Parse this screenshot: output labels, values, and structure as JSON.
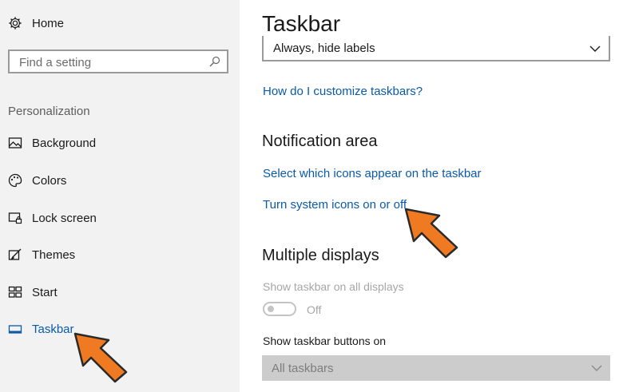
{
  "sidebar": {
    "home_label": "Home",
    "search_placeholder": "Find a setting",
    "section_label": "Personalization",
    "items": [
      {
        "label": "Background"
      },
      {
        "label": "Colors"
      },
      {
        "label": "Lock screen"
      },
      {
        "label": "Themes"
      },
      {
        "label": "Start"
      },
      {
        "label": "Taskbar",
        "active": true
      }
    ]
  },
  "main": {
    "title": "Taskbar",
    "labels_dropdown_value": "Always, hide labels",
    "customize_link": "How do I customize taskbars?",
    "notification_heading": "Notification area",
    "notification_links": [
      "Select which icons appear on the taskbar",
      "Turn system icons on or off"
    ],
    "multiple_heading": "Multiple displays",
    "show_all_label": "Show taskbar on all displays",
    "toggle_state": "Off",
    "buttons_on_label": "Show taskbar buttons on",
    "buttons_on_value": "All taskbars"
  },
  "colors": {
    "accent": "#0a5aa8",
    "arrow": "#f07a22"
  },
  "icons": {
    "home": "gear-icon",
    "search": "search-icon",
    "background": "picture-icon",
    "colors": "palette-icon",
    "lock_screen": "monitor-lock-icon",
    "themes": "brush-icon",
    "start": "tiles-icon",
    "taskbar": "taskbar-icon",
    "dropdown": "chevron-down-icon",
    "callout": "arrow-pointer-icon"
  }
}
